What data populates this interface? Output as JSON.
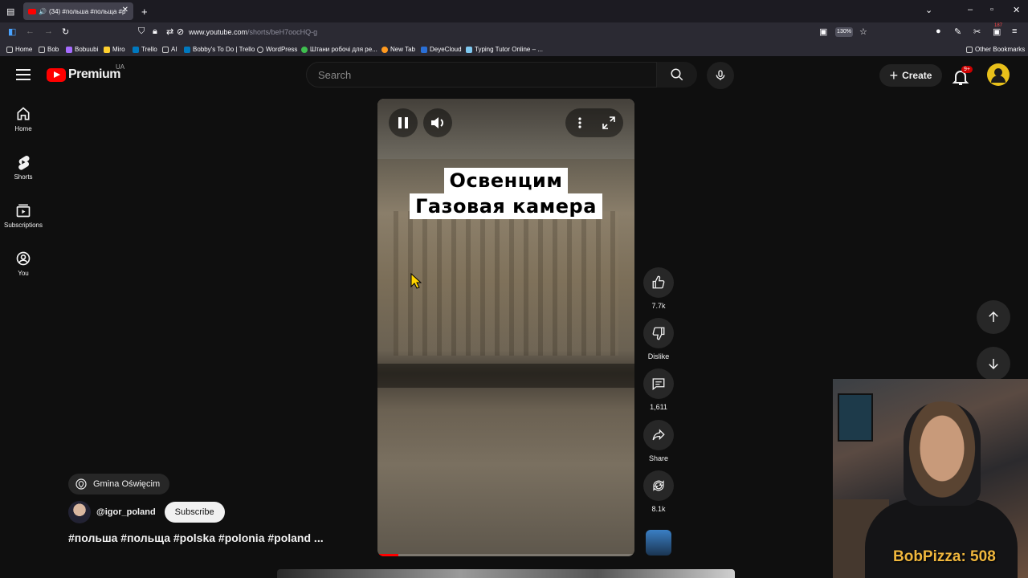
{
  "browser": {
    "tab_title": "(34) #польша #польща #p",
    "url_domain": "www.youtube.com",
    "url_path": "/shorts/beH7oocHQ-g",
    "zoom": "130%",
    "bookmarks": [
      "Home",
      "Bob",
      "Bobuubi",
      "Miro",
      "Trello",
      "AI",
      "Bobby's To Do | Trello",
      "WordPress",
      "Штани робочі для ре...",
      "New Tab",
      "DeyeCloud",
      "Typing Tutor Online – ..."
    ],
    "other_bookmarks": "Other Bookmarks",
    "extension_badge": "187"
  },
  "header": {
    "logo_text": "Premium",
    "country_code": "UA",
    "search_placeholder": "Search",
    "create_label": "Create",
    "notification_badge": "9+"
  },
  "sidebar": {
    "items": [
      {
        "label": "Home",
        "icon": "home-icon"
      },
      {
        "label": "Shorts",
        "icon": "shorts-icon"
      },
      {
        "label": "Subscriptions",
        "icon": "subscriptions-icon"
      },
      {
        "label": "You",
        "icon": "you-icon"
      }
    ]
  },
  "video": {
    "caption_line1": "Освенцим",
    "caption_line2": "Газовая камера",
    "progress": 0.08
  },
  "actions": {
    "likes": "7.7k",
    "dislike_label": "Dislike",
    "comments": "1,611",
    "share_label": "Share",
    "remix": "8.1k"
  },
  "meta": {
    "location": "Gmina Oświęcim",
    "channel": "@igor_poland",
    "subscribe_label": "Subscribe",
    "description": "#польша #польща #polska #polonia #poland ..."
  },
  "stream_overlay": {
    "text": "BobPizza: 508"
  },
  "colors": {
    "accent": "#ff0000",
    "overlay_text": "#f0b73d",
    "background": "#0f0f0f"
  }
}
